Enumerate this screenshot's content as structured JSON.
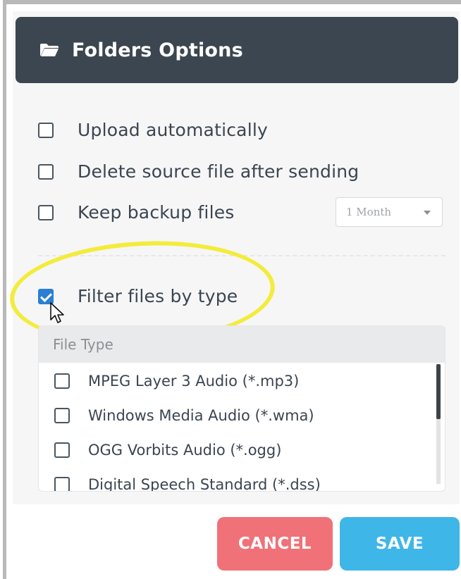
{
  "header": {
    "title": "Folders Options",
    "icon": "folder-icon"
  },
  "options": [
    {
      "label": "Upload automatically",
      "checked": false
    },
    {
      "label": "Delete source file after sending",
      "checked": false
    },
    {
      "label": "Keep backup files",
      "checked": false
    },
    {
      "label": "Filter files by type",
      "checked": true
    }
  ],
  "backup_select": {
    "value": "1 Month"
  },
  "file_types": {
    "header": "File Type",
    "items": [
      {
        "label": "MPEG Layer 3 Audio (*.mp3)",
        "checked": false
      },
      {
        "label": "Windows Media Audio (*.wma)",
        "checked": false
      },
      {
        "label": "OGG Vorbits Audio (*.ogg)",
        "checked": false
      },
      {
        "label": "Digital Speech Standard (*.dss)",
        "checked": false
      }
    ]
  },
  "buttons": {
    "cancel": "CANCEL",
    "save": "SAVE"
  },
  "colors": {
    "header_bg": "#3c4650",
    "checkbox_checked": "#2a7fd4",
    "cancel_button": "#f07178",
    "save_button": "#3fb6e8",
    "highlight_ellipse": "#f3ec3a"
  }
}
